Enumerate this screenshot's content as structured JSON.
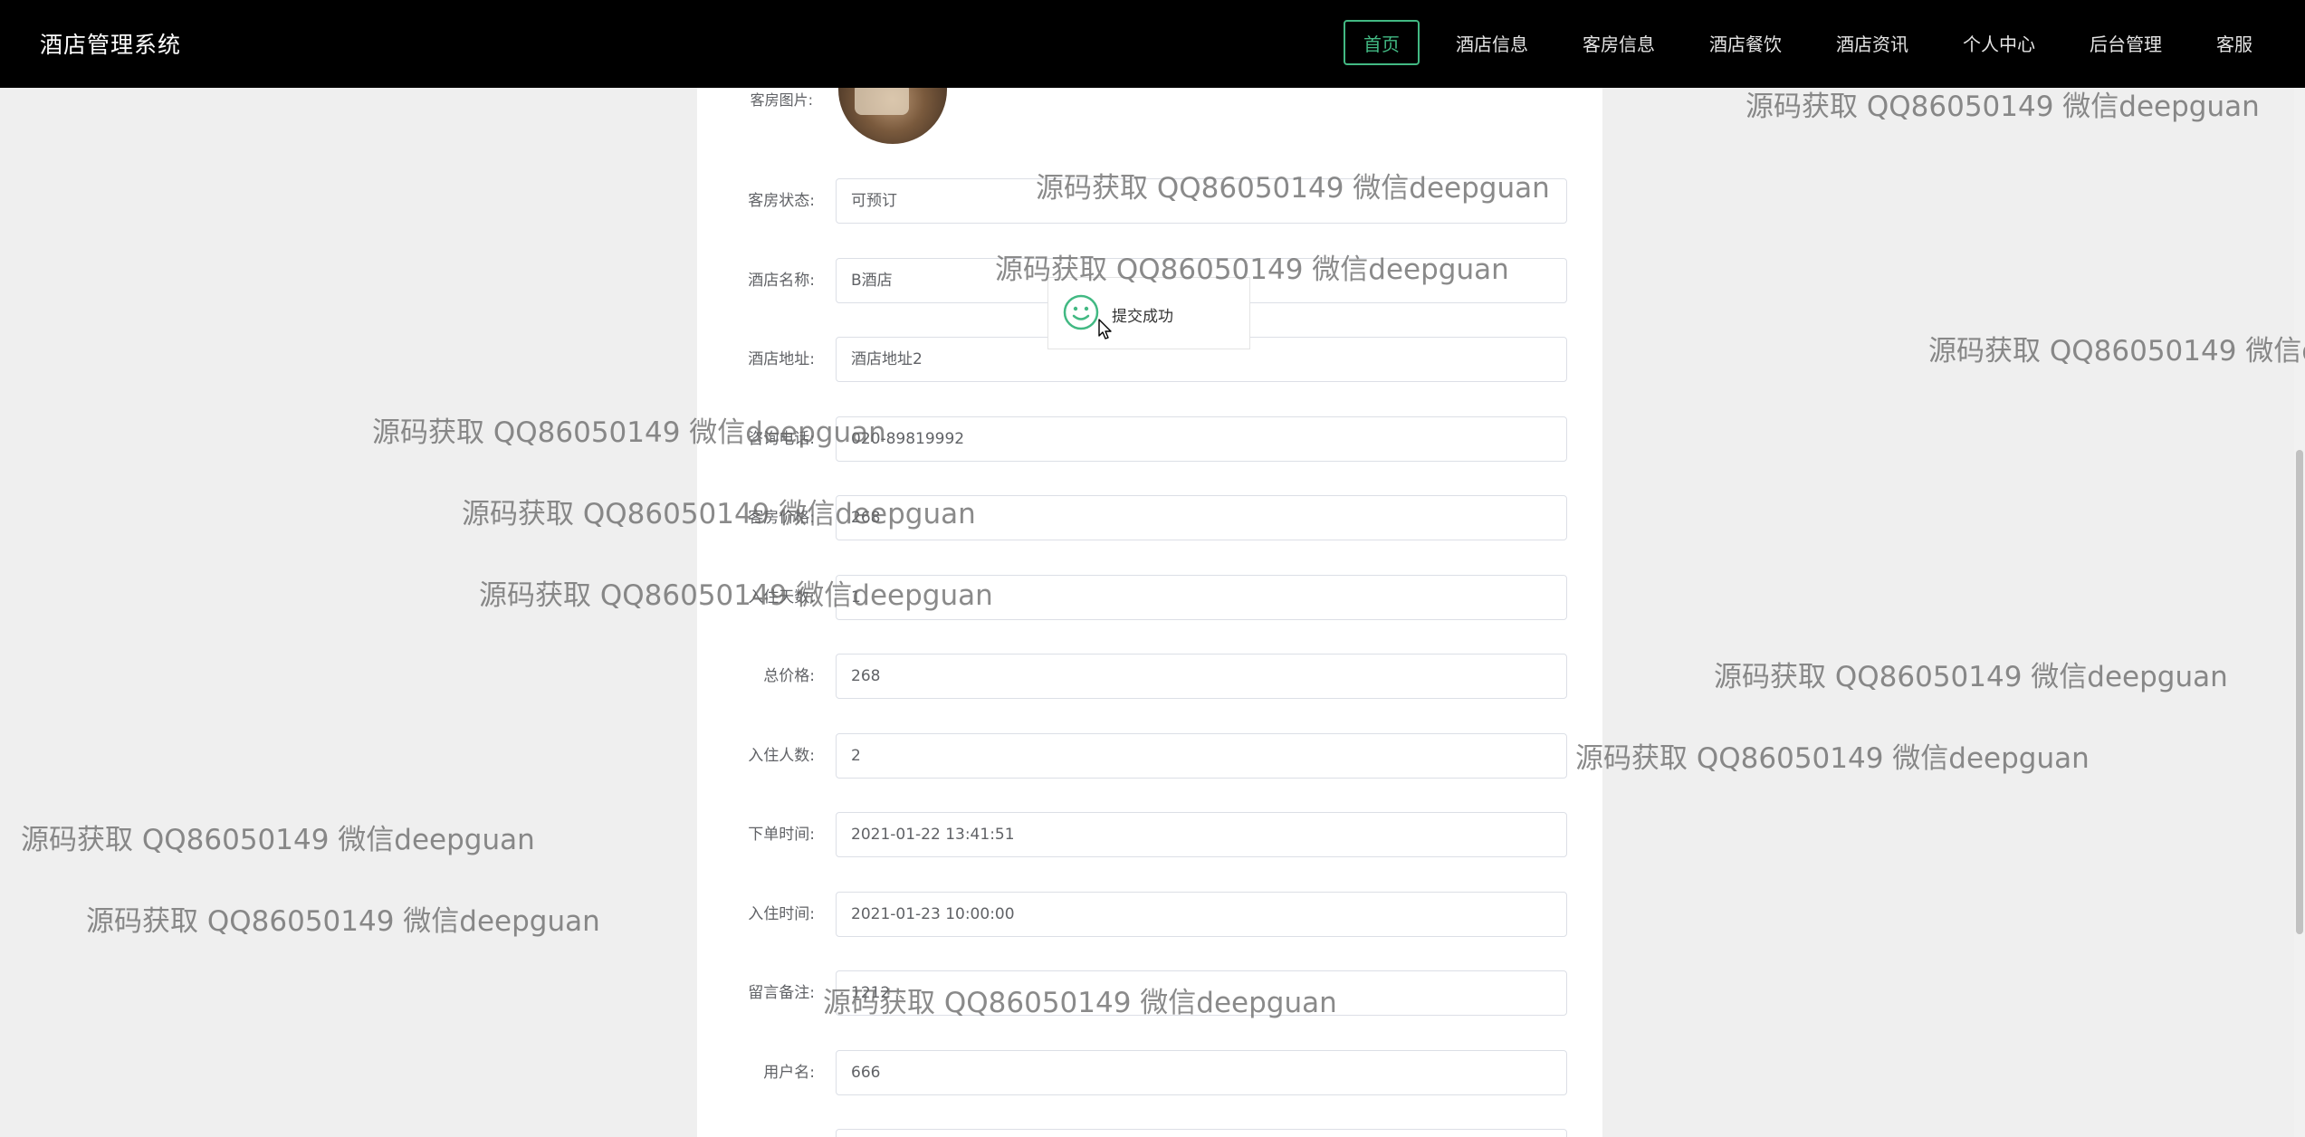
{
  "app": {
    "title": "酒店管理系统"
  },
  "nav": {
    "items": [
      {
        "label": "首页",
        "active": true
      },
      {
        "label": "酒店信息"
      },
      {
        "label": "客房信息"
      },
      {
        "label": "酒店餐饮"
      },
      {
        "label": "酒店资讯"
      },
      {
        "label": "个人中心"
      },
      {
        "label": "后台管理"
      },
      {
        "label": "客服"
      }
    ]
  },
  "form": {
    "avatar_label": "客房图片:",
    "fields": [
      {
        "label": "客房状态:",
        "value": "可预订"
      },
      {
        "label": "酒店名称:",
        "value": "B酒店"
      },
      {
        "label": "酒店地址:",
        "value": "酒店地址2"
      },
      {
        "label": "咨询电话:",
        "value": "020-89819992"
      },
      {
        "label": "客房价格:",
        "value": "268"
      },
      {
        "label": "入住天数:",
        "value": "1"
      },
      {
        "label": "总价格:",
        "value": "268"
      },
      {
        "label": "入住人数:",
        "value": "2"
      },
      {
        "label": "下单时间:",
        "value": "2021-01-22 13:41:51"
      },
      {
        "label": "入住时间:",
        "value": "2021-01-23 10:00:00"
      },
      {
        "label": "留言备注:",
        "value": "1212"
      },
      {
        "label": "用户名:",
        "value": "666"
      }
    ]
  },
  "toast": {
    "message": "提交成功",
    "icon": "smile-icon",
    "color": "#42b983"
  },
  "watermark": {
    "text": "源码获取 QQ86050149 微信deepguan"
  },
  "colors": {
    "accent": "#42b983",
    "topbar": "#000000",
    "background": "#efefef"
  }
}
